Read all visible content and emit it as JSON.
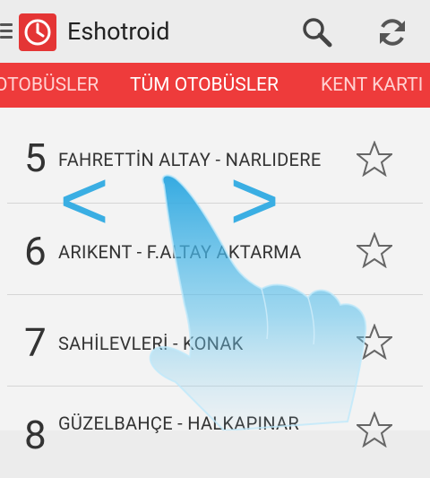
{
  "app": {
    "title": "Eshotroid"
  },
  "tabs": [
    {
      "label": "OTOBÜSLER",
      "active": false
    },
    {
      "label": "TÜM OTOBÜSLER",
      "active": true
    },
    {
      "label": "KENT KARTI",
      "active": false
    }
  ],
  "routes": [
    {
      "number": "5",
      "name": "FAHRETTİN ALTAY - NARLIDERE"
    },
    {
      "number": "6",
      "name": "ARIKENT - F.ALTAY AKTARMA"
    },
    {
      "number": "7",
      "name": "SAHİLEVLERİ - KONAK"
    },
    {
      "number": "8",
      "name": "GÜZELBAHÇE - HALKAPINAR"
    }
  ],
  "overlay": {
    "left_arrow": "<",
    "right_arrow": ">"
  },
  "colors": {
    "accent": "#ee3b3b",
    "icon_red": "#e43535",
    "hint_blue": "#3aaee3"
  },
  "icons": {
    "menu": "hamburger-icon",
    "app": "clock-icon",
    "search": "search-icon",
    "refresh": "refresh-icon",
    "favorite": "star-outline-icon"
  }
}
